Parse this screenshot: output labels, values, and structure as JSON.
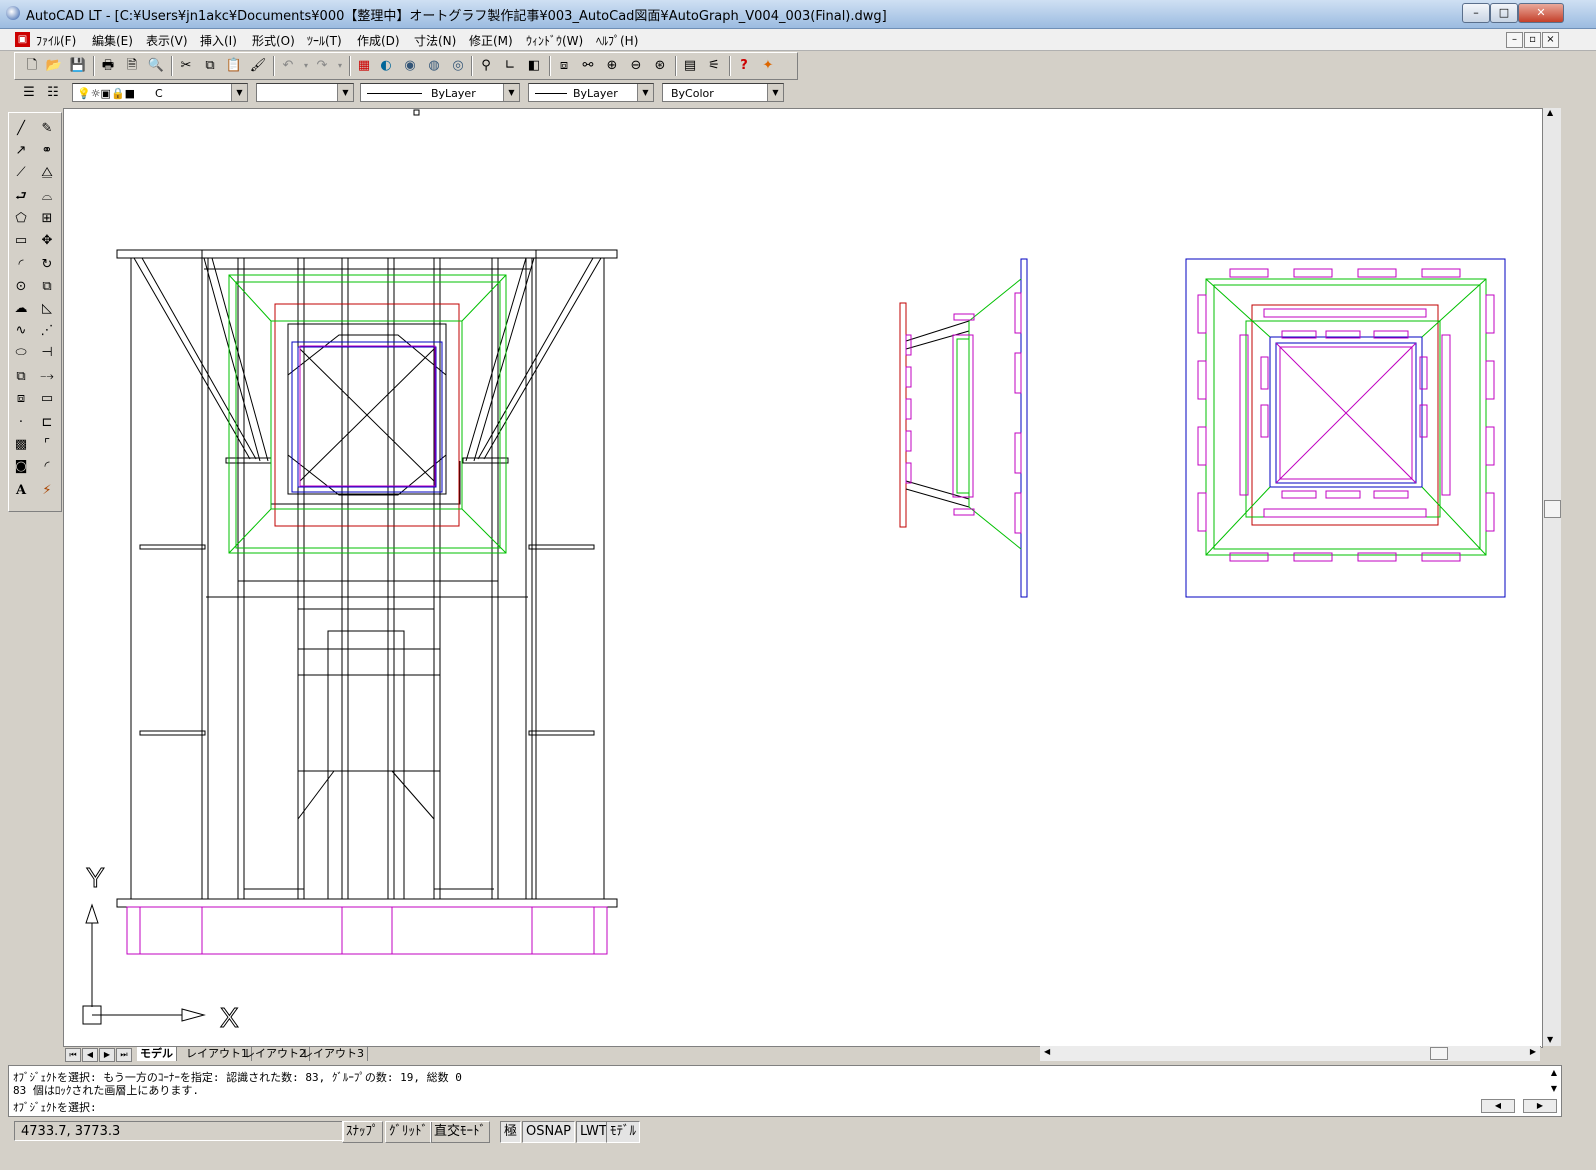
{
  "window": {
    "title": "AutoCAD LT - [C:¥Users¥jn1akc¥Documents¥000【整理中】オートグラフ製作記事¥003_AutoCad図面¥AutoGraph_V004_003(Final).dwg]",
    "min_label": "–",
    "max_label": "□",
    "close_label": "✕"
  },
  "menu": {
    "items": [
      "ﾌｧｲﾙ(F)",
      "編集(E)",
      "表示(V)",
      "挿入(I)",
      "形式(O)",
      "ﾂｰﾙ(T)",
      "作成(D)",
      "寸法(N)",
      "修正(M)",
      "ｳｨﾝﾄﾞｳ(W)",
      "ﾍﾙﾌﾟ(H)"
    ],
    "doc_min": "–",
    "doc_restore": "▫",
    "doc_close": "×"
  },
  "properties": {
    "layer_value": "C",
    "linetype": "ByLayer",
    "lineweight": "ByLayer",
    "color": "ByColor"
  },
  "drawing": {
    "ucs_y": "Y",
    "ucs_x": "X"
  },
  "tabs": [
    "モデル",
    "レイアウト1",
    "レイアウト2",
    "レイアウト3"
  ],
  "command": {
    "line1": "ｵﾌﾞｼﾞｪｸﾄを選択: もう一方のｺｰﾅｰを指定: 認識された数: 83, ｸﾞﾙｰﾌﾟの数: 19, 総数 0",
    "line2": "83 個はﾛｯｸされた画層上にあります.",
    "line3": "ｵﾌﾞｼﾞｪｸﾄを選択:"
  },
  "status": {
    "coords": "4733.7, 3773.3",
    "buttons": [
      "ｽﾅｯﾌﾟ",
      "ｸﾞﾘｯﾄﾞ",
      "直交ﾓｰﾄﾞ",
      "極",
      "OSNAP",
      "LWT",
      "ﾓﾃﾞﾙ"
    ],
    "active": [
      "極",
      "OSNAP",
      "LWT",
      "ﾓﾃﾞﾙ"
    ]
  },
  "colors": {
    "line_black": "#000000",
    "line_red": "#c00000",
    "line_green": "#00c000",
    "line_blue": "#0000c0",
    "line_magenta": "#c000c0"
  }
}
